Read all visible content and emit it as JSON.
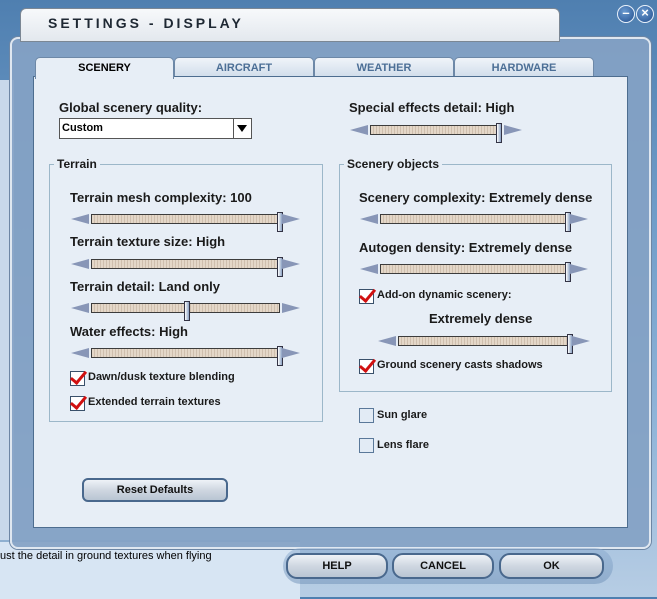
{
  "window": {
    "title": "SETTINGS - DISPLAY",
    "minimize_label": "–",
    "close_label": "×"
  },
  "tabs": [
    {
      "label": "SCENERY",
      "active": true
    },
    {
      "label": "AIRCRAFT",
      "active": false
    },
    {
      "label": "WEATHER",
      "active": false
    },
    {
      "label": "HARDWARE",
      "active": false
    }
  ],
  "global_quality": {
    "label": "Global scenery quality:",
    "value": "Custom"
  },
  "special_effects": {
    "label": "Special effects detail: High",
    "level": 0.98
  },
  "terrain": {
    "group_title": "Terrain",
    "mesh": {
      "label": "Terrain mesh complexity: 100",
      "level": 1.0
    },
    "texture": {
      "label": "Terrain texture size: High",
      "level": 1.0
    },
    "detail": {
      "label": "Terrain detail: Land only",
      "level": 0.5
    },
    "water": {
      "label": "Water effects: High",
      "level": 1.0
    },
    "dawn_dusk": {
      "label": "Dawn/dusk texture blending",
      "checked": true
    },
    "extended": {
      "label": "Extended terrain textures",
      "checked": true
    }
  },
  "scenery_objects": {
    "group_title": "Scenery objects",
    "complexity": {
      "label": "Scenery complexity: Extremely dense",
      "level": 1.0
    },
    "autogen": {
      "label": "Autogen density: Extremely dense",
      "level": 1.0
    },
    "addon": {
      "label": "Add-on dynamic scenery:",
      "checked": true
    },
    "addon_value": {
      "label": "Extremely dense",
      "level": 1.0
    },
    "shadows": {
      "label": "Ground scenery casts shadows",
      "checked": true
    }
  },
  "sun_glare": {
    "label": "Sun glare",
    "checked": false
  },
  "lens_flare": {
    "label": "Lens flare",
    "checked": false
  },
  "reset_label": "Reset Defaults",
  "buttons": {
    "help": "HELP",
    "cancel": "CANCEL",
    "ok": "OK"
  },
  "hint_text": "ust the detail in ground textures when flying"
}
